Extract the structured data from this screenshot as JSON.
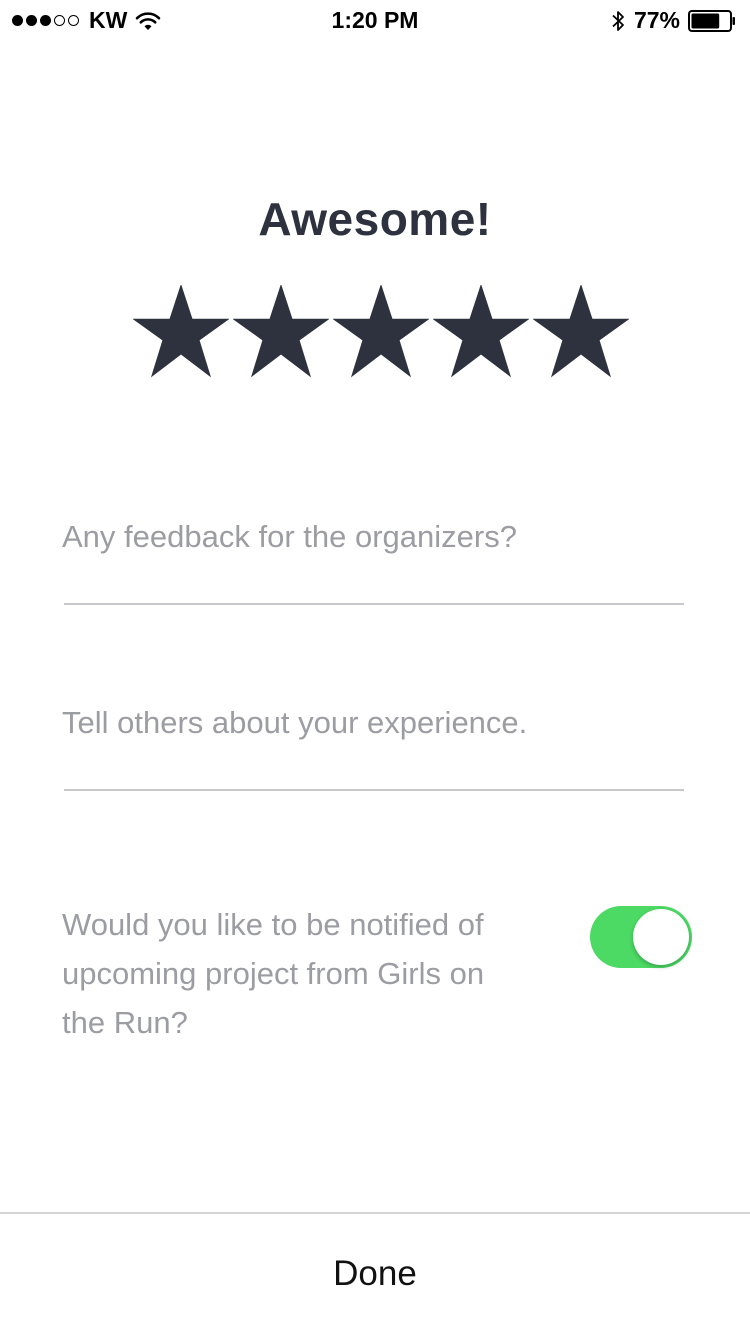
{
  "status_bar": {
    "signal_filled": 3,
    "signal_total": 5,
    "carrier": "KW",
    "time": "1:20 PM",
    "battery_percent": "77%",
    "battery_level": 0.77
  },
  "rating": {
    "title": "Awesome!",
    "stars_filled": 5,
    "stars_total": 5,
    "star_color": "#2e323f"
  },
  "feedback": {
    "placeholder": "Any feedback for the organizers?",
    "value": ""
  },
  "experience": {
    "placeholder": "Tell others about your experience.",
    "value": ""
  },
  "notify": {
    "text": "Would you like to be notified of upcoming project from Girls on the Run?",
    "enabled": true,
    "toggle_color": "#4cd964"
  },
  "footer": {
    "done_label": "Done"
  }
}
